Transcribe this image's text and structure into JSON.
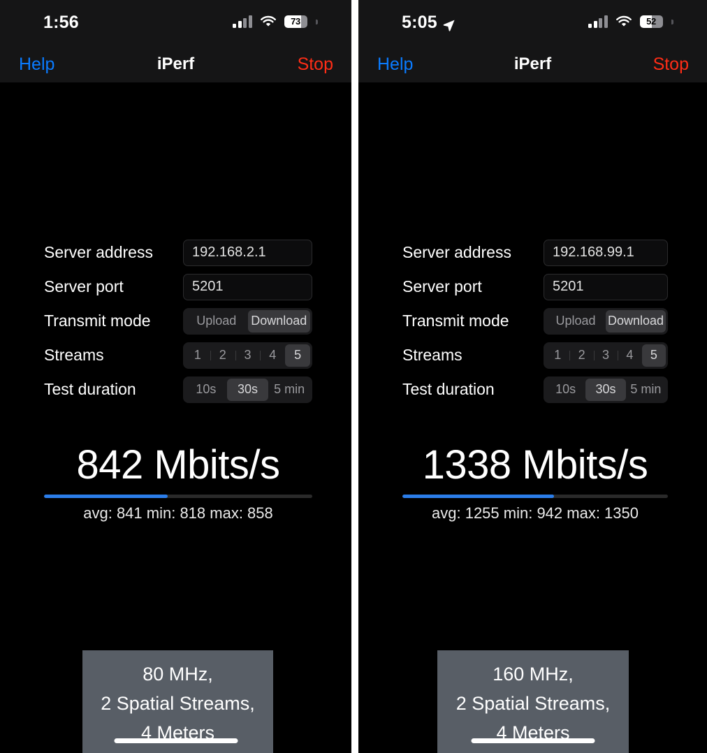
{
  "panels": [
    {
      "id": "left",
      "status": {
        "time": "1:56",
        "location_arrow": false,
        "cellular_icon": "cellular-bars-icon",
        "wifi_icon": "wifi-icon",
        "battery_percent": "73",
        "battery_level": 73
      },
      "nav": {
        "left_label": "Help",
        "title": "iPerf",
        "right_label": "Stop"
      },
      "form": {
        "server_address_label": "Server address",
        "server_address_value": "192.168.2.1",
        "server_port_label": "Server port",
        "server_port_value": "5201",
        "transmit_mode_label": "Transmit mode",
        "transmit_mode_options": [
          "Upload",
          "Download"
        ],
        "transmit_mode_selected": "Download",
        "streams_label": "Streams",
        "streams_options": [
          "1",
          "2",
          "3",
          "4",
          "5"
        ],
        "streams_selected": "5",
        "test_duration_label": "Test duration",
        "test_duration_options": [
          "10s",
          "30s",
          "5 min"
        ],
        "test_duration_selected": "30s"
      },
      "result": {
        "speed": "842 Mbits/s",
        "progress_percent": 46,
        "stats": "avg: 841 min: 818 max: 858"
      },
      "annotation": [
        "80 MHz,",
        "2 Spatial Streams,",
        "4 Meters"
      ]
    },
    {
      "id": "right",
      "status": {
        "time": "5:05",
        "location_arrow": true,
        "cellular_icon": "cellular-bars-icon",
        "wifi_icon": "wifi-icon",
        "battery_percent": "52",
        "battery_level": 52
      },
      "nav": {
        "left_label": "Help",
        "title": "iPerf",
        "right_label": "Stop"
      },
      "form": {
        "server_address_label": "Server address",
        "server_address_value": "192.168.99.1",
        "server_port_label": "Server port",
        "server_port_value": "5201",
        "transmit_mode_label": "Transmit mode",
        "transmit_mode_options": [
          "Upload",
          "Download"
        ],
        "transmit_mode_selected": "Download",
        "streams_label": "Streams",
        "streams_options": [
          "1",
          "2",
          "3",
          "4",
          "5"
        ],
        "streams_selected": "5",
        "test_duration_label": "Test duration",
        "test_duration_options": [
          "10s",
          "30s",
          "5 min"
        ],
        "test_duration_selected": "30s"
      },
      "result": {
        "speed": "1338 Mbits/s",
        "progress_percent": 57,
        "stats": "avg: 1255 min: 942 max: 1350"
      },
      "annotation": [
        "160 MHz,",
        "2 Spatial Streams,",
        "4 Meters"
      ]
    }
  ],
  "colors": {
    "accent_link": "#0a7bff",
    "accent_stop": "#ff2d16",
    "progress_fill": "#2b7de9",
    "annotation_bg": "#585e66",
    "screen_bg": "#000000",
    "chrome_bg": "#151516"
  }
}
